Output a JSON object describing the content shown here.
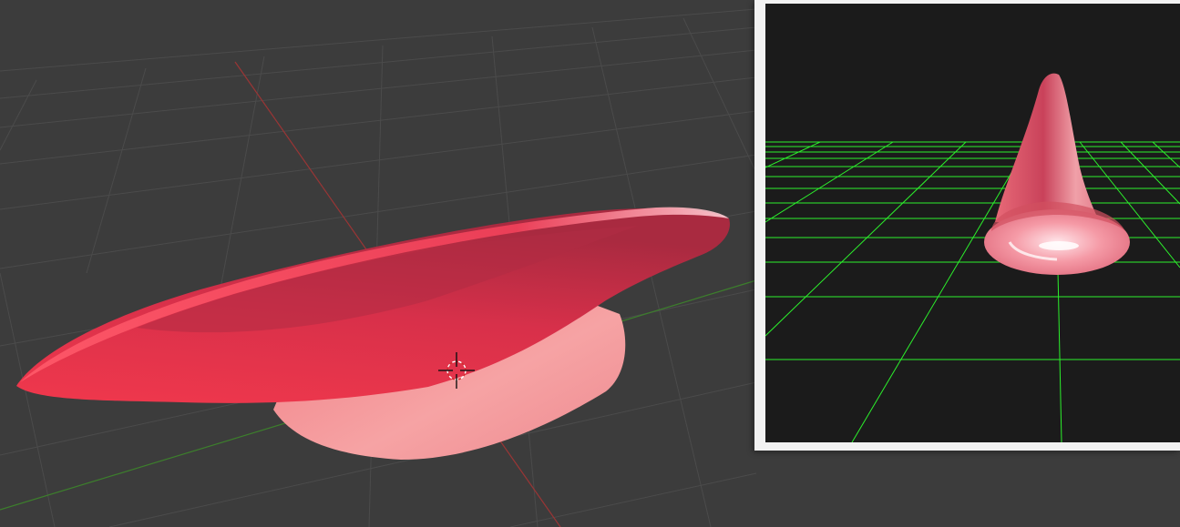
{
  "colors": {
    "viewport_background": "#3c3c3c",
    "viewport_grid": "#4a4a4a",
    "x_axis": "#b03a3a",
    "y_axis": "#3f8a2f",
    "mesh_red": "#e8334a",
    "mesh_pink": "#f39a9c",
    "preview_background": "#1b1b1b",
    "preview_grid": "#2cff2c",
    "preview_frame": "#f2f2f2"
  },
  "icons": {
    "cursor": "3d-cursor-crosshair-icon"
  }
}
